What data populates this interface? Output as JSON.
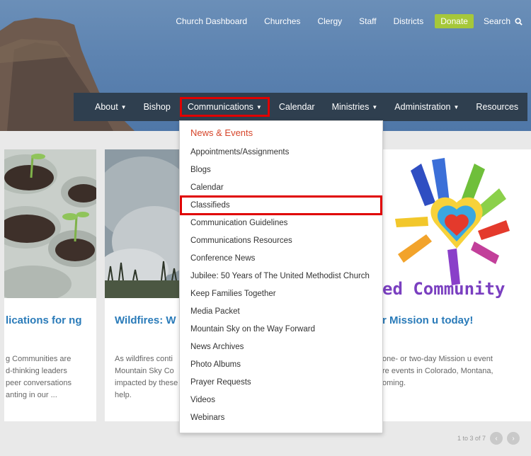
{
  "topnav": {
    "items": [
      "Church Dashboard",
      "Churches",
      "Clergy",
      "Staff",
      "Districts"
    ],
    "donate": "Donate",
    "search": "Search"
  },
  "mainnav": {
    "items": [
      {
        "label": "About",
        "caret": true
      },
      {
        "label": "Bishop",
        "caret": false
      },
      {
        "label": "Communications",
        "caret": true
      },
      {
        "label": "Calendar",
        "caret": false
      },
      {
        "label": "Ministries",
        "caret": true
      },
      {
        "label": "Administration",
        "caret": true
      },
      {
        "label": "Resources",
        "caret": false
      }
    ]
  },
  "dropdown": {
    "heading": "News & Events",
    "items": [
      "Appointments/Assignments",
      "Blogs",
      "Calendar",
      "Classifieds",
      "Communication Guidelines",
      "Communications Resources",
      "Conference News",
      "Jubilee: 50 Years of The United Methodist Church",
      "Keep Families Together",
      "Media Packet",
      "Mountain Sky on the Way Forward",
      "News Archives",
      "Photo Albums",
      "Prayer Requests",
      "Videos",
      "Webinars"
    ]
  },
  "cards": [
    {
      "title": "lications for\nng",
      "text": "g Communities are\nd-thinking leaders\npeer conversations\nanting in our ..."
    },
    {
      "title": "Wildfires: W",
      "text": "As wildfires conti\nMountain Sky Co\nimpacted by these\nhelp."
    },
    {
      "title": "r Mission u today!",
      "text": "one- or two-day Mission u event\nre events in Colorado, Montana,\noming.",
      "image_text": "ed Community"
    }
  ],
  "pager": {
    "text": "1 to 3 of 7",
    "prev": "‹",
    "next": "›"
  },
  "colors": {
    "accent": "#d6452a",
    "nav": "#2f3f4f",
    "donate": "#a6c83a",
    "link": "#2a7bb9",
    "highlight": "#e00000"
  }
}
